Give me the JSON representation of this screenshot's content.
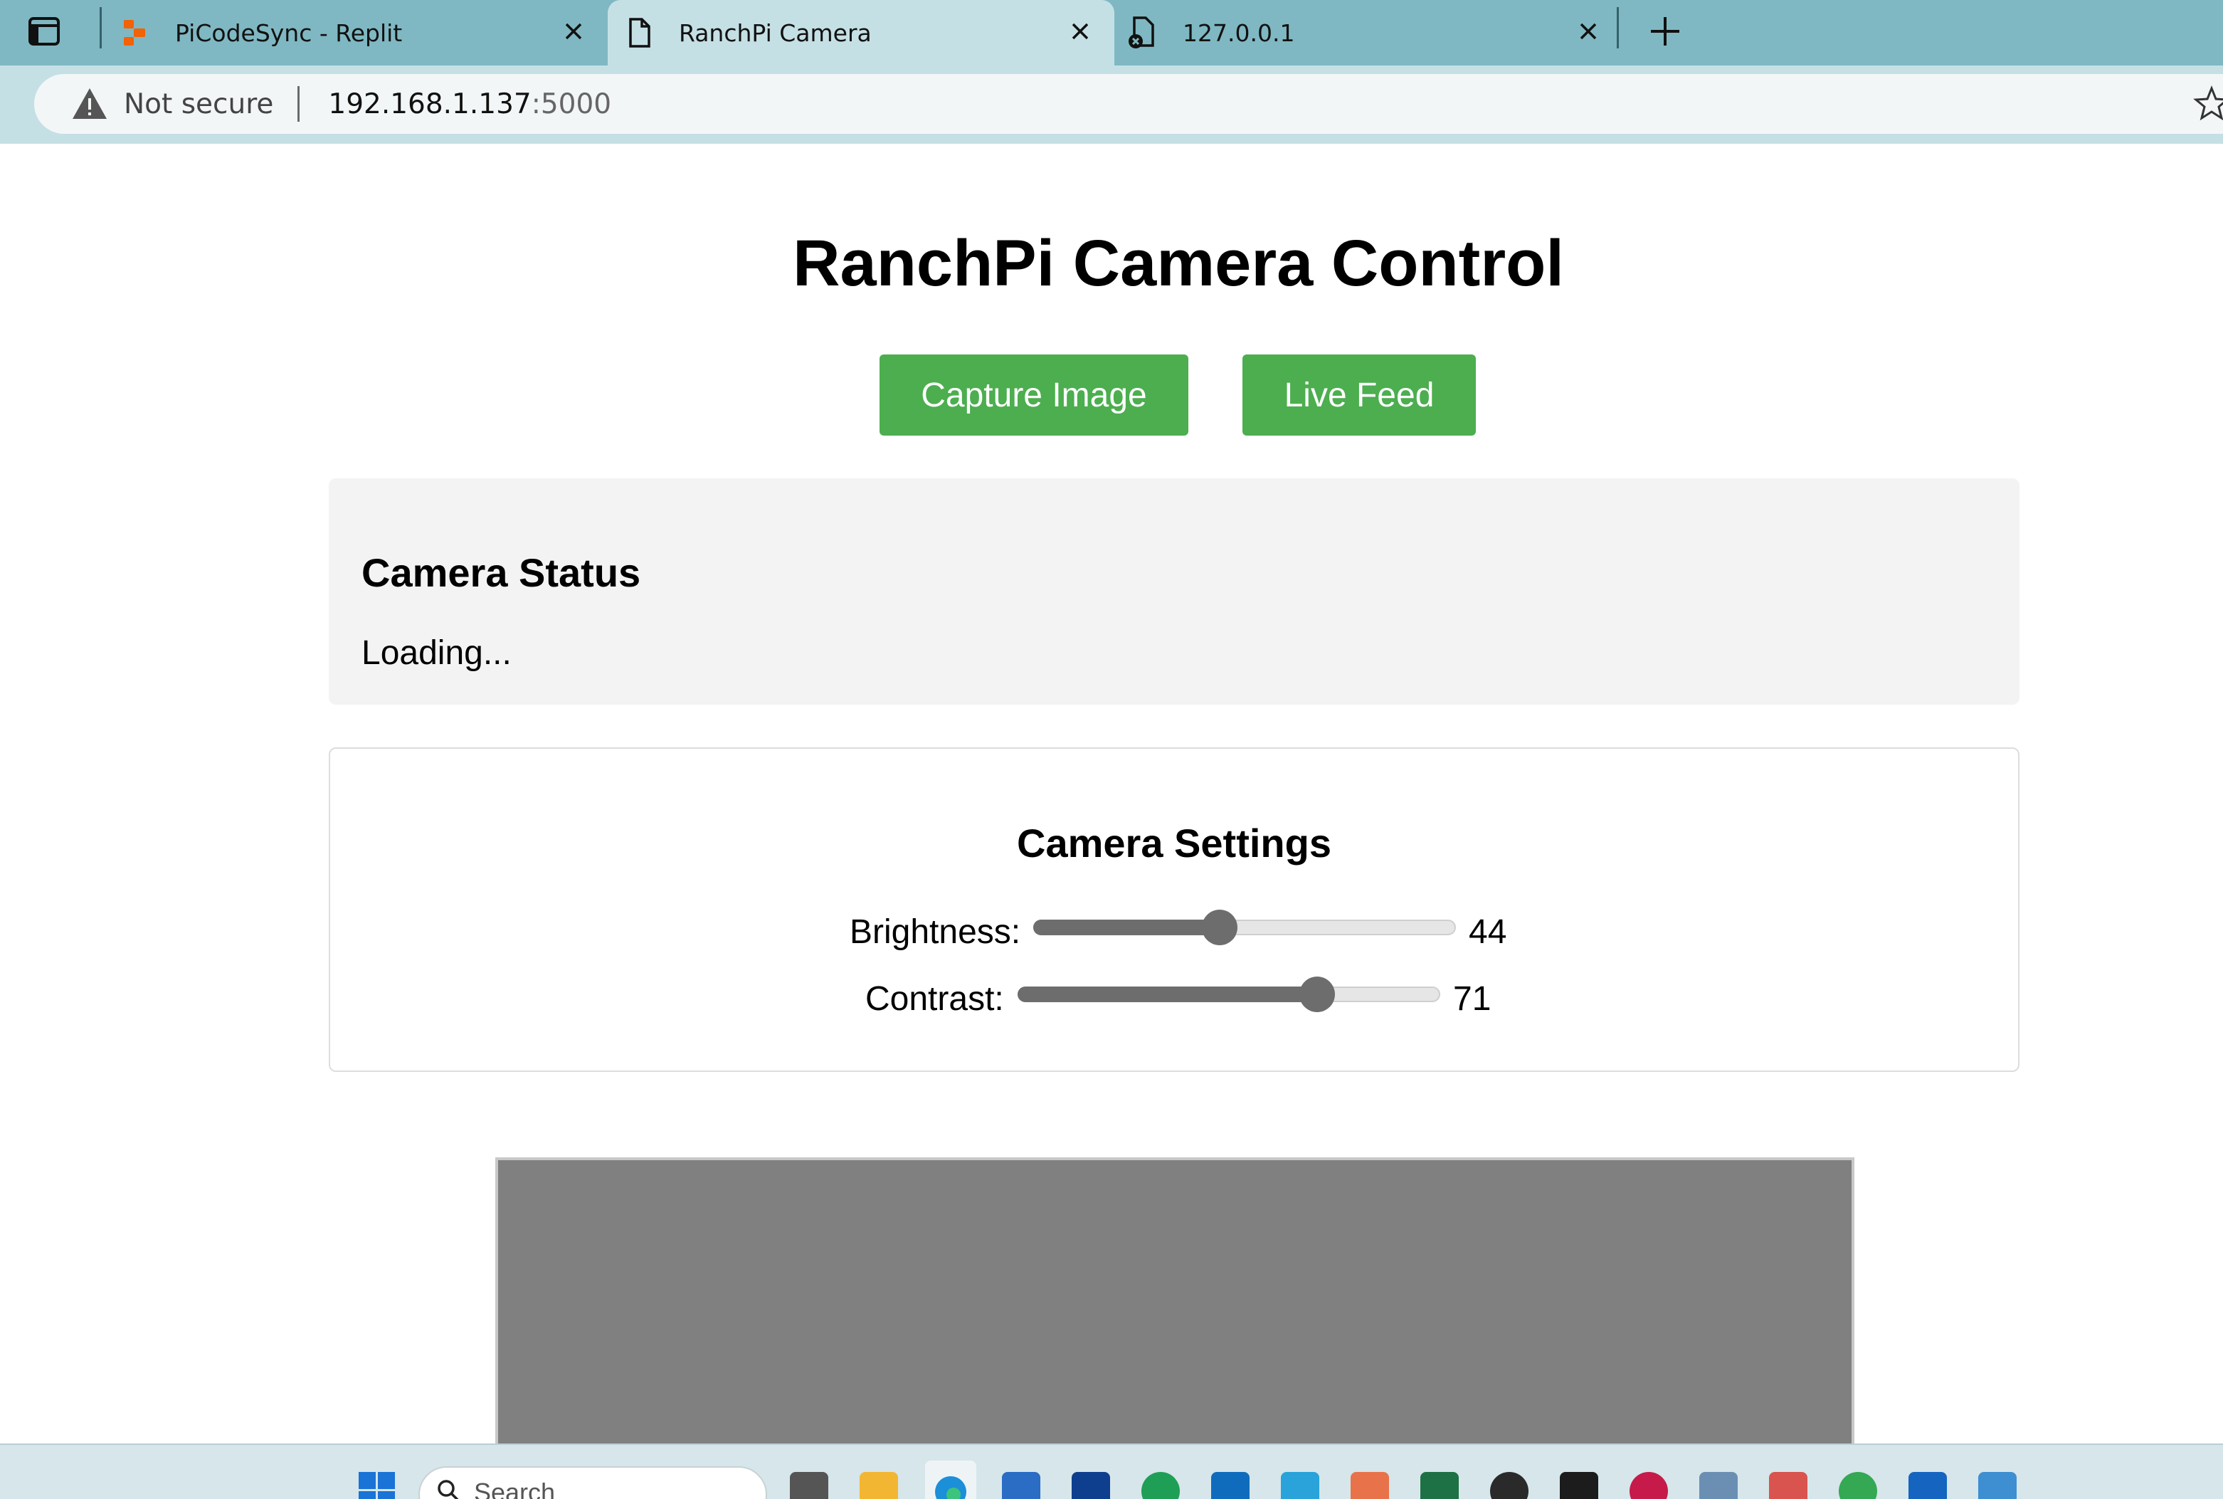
{
  "browser": {
    "tabs": [
      {
        "title": "PiCodeSync - Replit",
        "icon": "replit-icon",
        "active": false
      },
      {
        "title": "RanchPi Camera",
        "icon": "page-icon",
        "active": true
      },
      {
        "title": "127.0.0.1",
        "icon": "error-page-icon",
        "active": false
      }
    ],
    "security_label": "Not secure",
    "url_host": "192.168.1.137",
    "url_port": ":5000"
  },
  "page": {
    "title": "RanchPi Camera Control",
    "capture_button": "Capture Image",
    "live_feed_button": "Live Feed",
    "status": {
      "heading": "Camera Status",
      "text": "Loading..."
    },
    "settings": {
      "heading": "Camera Settings",
      "brightness_label": "Brightness:",
      "brightness_value": "44",
      "brightness_level": 0.44,
      "contrast_label": "Contrast:",
      "contrast_value": "71",
      "contrast_level": 0.71
    }
  },
  "taskbar": {
    "search_placeholder": "Search"
  },
  "colors": {
    "button_green": "#4cae4f",
    "tabbar": "#7fb8c2",
    "active_tab": "#c5e0e5"
  }
}
